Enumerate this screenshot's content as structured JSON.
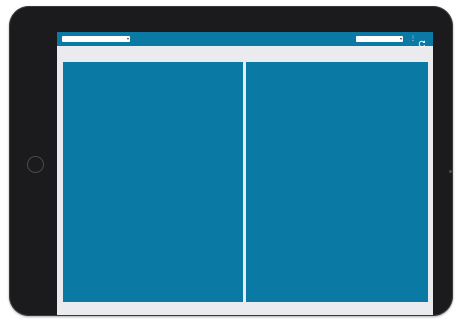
{
  "header": {
    "left_select_value": "",
    "title": "",
    "right_select_value": ""
  },
  "colors": {
    "accent": "#0a7aa5",
    "background": "#e9ebee",
    "device_frame": "#1b1b1d"
  },
  "icons": {
    "left_dropdown": "chevron-down-icon",
    "right_dropdown": "chevron-down-icon",
    "more": "more-options-icon",
    "refresh": "refresh-icon"
  }
}
